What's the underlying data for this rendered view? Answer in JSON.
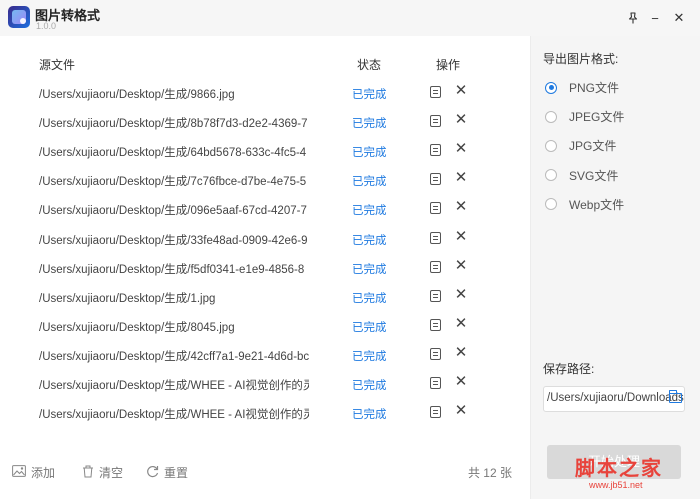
{
  "titlebar": {
    "title": "图片转格式",
    "version": "1.0.0",
    "pin_icon": "📌",
    "minimize_icon": "−",
    "close_icon": "✕"
  },
  "table": {
    "headers": {
      "source": "源文件",
      "status": "状态",
      "action": "操作"
    },
    "rows": [
      {
        "path": "/Users/xujiaoru/Desktop/生成/9866.jpg",
        "status": "已完成"
      },
      {
        "path": "/Users/xujiaoru/Desktop/生成/8b78f7d3-d2e2-4369-7",
        "status": "已完成"
      },
      {
        "path": "/Users/xujiaoru/Desktop/生成/64bd5678-633c-4fc5-4",
        "status": "已完成"
      },
      {
        "path": "/Users/xujiaoru/Desktop/生成/7c76fbce-d7be-4e75-5",
        "status": "已完成"
      },
      {
        "path": "/Users/xujiaoru/Desktop/生成/096e5aaf-67cd-4207-7",
        "status": "已完成"
      },
      {
        "path": "/Users/xujiaoru/Desktop/生成/33fe48ad-0909-42e6-9",
        "status": "已完成"
      },
      {
        "path": "/Users/xujiaoru/Desktop/生成/f5df0341-e1e9-4856-8",
        "status": "已完成"
      },
      {
        "path": "/Users/xujiaoru/Desktop/生成/1.jpg",
        "status": "已完成"
      },
      {
        "path": "/Users/xujiaoru/Desktop/生成/8045.jpg",
        "status": "已完成"
      },
      {
        "path": "/Users/xujiaoru/Desktop/生成/42cff7a1-9e21-4d6d-bc",
        "status": "已完成"
      },
      {
        "path": "/Users/xujiaoru/Desktop/生成/WHEE - AI视觉创作的灵",
        "status": "已完成"
      },
      {
        "path": "/Users/xujiaoru/Desktop/生成/WHEE - AI视觉创作的灵",
        "status": "已完成"
      }
    ],
    "delete_glyph": "✕"
  },
  "footer": {
    "add_label": "添加",
    "clear_label": "清空",
    "reset_label": "重置",
    "count_label": "共 12 张",
    "add_icon": "🖼",
    "clear_icon": "🗑",
    "reset_icon": "⟳"
  },
  "side": {
    "format_label": "导出图片格式:",
    "formats": [
      {
        "label": "PNG文件",
        "selected": true
      },
      {
        "label": "JPEG文件",
        "selected": false
      },
      {
        "label": "JPG文件",
        "selected": false
      },
      {
        "label": "SVG文件",
        "selected": false
      },
      {
        "label": "Webp文件",
        "selected": false
      }
    ],
    "save_label": "保存路径:",
    "save_path": "/Users/xujiaoru/Downloads",
    "start_label": "开始处理"
  },
  "watermark": {
    "main": "脚本之家",
    "sub": "www.jb51.net"
  },
  "colors": {
    "accent": "#1f7ae0",
    "sidebar_bg": "#f5f5f5",
    "disabled_button": "#d9d9d9",
    "watermark": "#e8433b"
  }
}
